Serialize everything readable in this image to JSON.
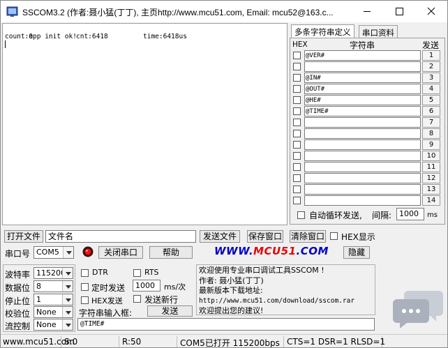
{
  "window": {
    "title": "SSCOM3.2 (作者:聂小猛(丁丁), 主页http://www.mcu51.com,  Email: mcu52@163.c..."
  },
  "receive": {
    "lines": [
      {
        "a": "app init ok!",
        "b": "",
        "c": ""
      },
      {
        "a": "count:0",
        "b": "cnt:6418",
        "c": "time:6418us"
      }
    ]
  },
  "tabs": [
    {
      "label": "多条字符串定义",
      "active": true
    },
    {
      "label": "串口资料",
      "active": false
    }
  ],
  "multi": {
    "hex_header": "HEX",
    "str_header": "字符串",
    "send_header": "发送",
    "rows": [
      {
        "value": "@VER#",
        "btn": "1"
      },
      {
        "value": "",
        "btn": "2"
      },
      {
        "value": "@IN#",
        "btn": "3"
      },
      {
        "value": "@OUT#",
        "btn": "4"
      },
      {
        "value": "@HE#",
        "btn": "5"
      },
      {
        "value": "@TIME#",
        "btn": "6"
      },
      {
        "value": "",
        "btn": "7"
      },
      {
        "value": "",
        "btn": "8"
      },
      {
        "value": "",
        "btn": "9"
      },
      {
        "value": "",
        "btn": "10"
      },
      {
        "value": "",
        "btn": "11"
      },
      {
        "value": "",
        "btn": "12"
      },
      {
        "value": "",
        "btn": "13"
      },
      {
        "value": "",
        "btn": "14"
      }
    ],
    "loop_label": "自动循环发送,",
    "interval_label": "间隔:",
    "interval_value": "1000",
    "interval_unit": "ms"
  },
  "row1": {
    "open_file": "打开文件",
    "filename": "文件名",
    "send_file": "发送文件",
    "save_window": "保存窗口",
    "clear_window": "清除窗口",
    "hex_display": "HEX显示"
  },
  "row2": {
    "port_label": "串口号",
    "port_value": "COM5",
    "close_port": "关闭串口",
    "help": "帮助",
    "website": "WWW.MCU51.COM",
    "hide": "隐藏"
  },
  "settings": {
    "baud_label": "波特率",
    "baud_value": "115200",
    "data_label": "数据位",
    "data_value": "8",
    "stop_label": "停止位",
    "stop_value": "1",
    "parity_label": "校验位",
    "parity_value": "None",
    "flow_label": "流控制",
    "flow_value": "None"
  },
  "options": {
    "dtr": "DTR",
    "rts": "RTS",
    "timed_send": "定时发送",
    "period_value": "1000",
    "period_unit": "ms/次",
    "hex_send": "HEX发送",
    "send_newline": "发送新行",
    "input_label": "字符串输入框:",
    "send_btn": "发送",
    "input_value": "@TIME#"
  },
  "info": {
    "line1": "欢迎使用专业串口调试工具SSCOM !",
    "line2": "作者: 聂小猛(丁丁)",
    "line3": "最新版本下载地址:",
    "line4": "http://www.mcu51.com/download/sscom.rar",
    "line5": "欢迎提出您的建议!"
  },
  "status": {
    "website": "www.mcu51.com",
    "sent": "S:0",
    "recv": "R:50",
    "port_state": "COM5已打开  115200bps",
    "lines": "CTS=1 DSR=1 RLSD=1"
  },
  "colors": {
    "website_blue": "#0000cc",
    "website_red": "#ee0000",
    "record_red": "#cc0000"
  }
}
